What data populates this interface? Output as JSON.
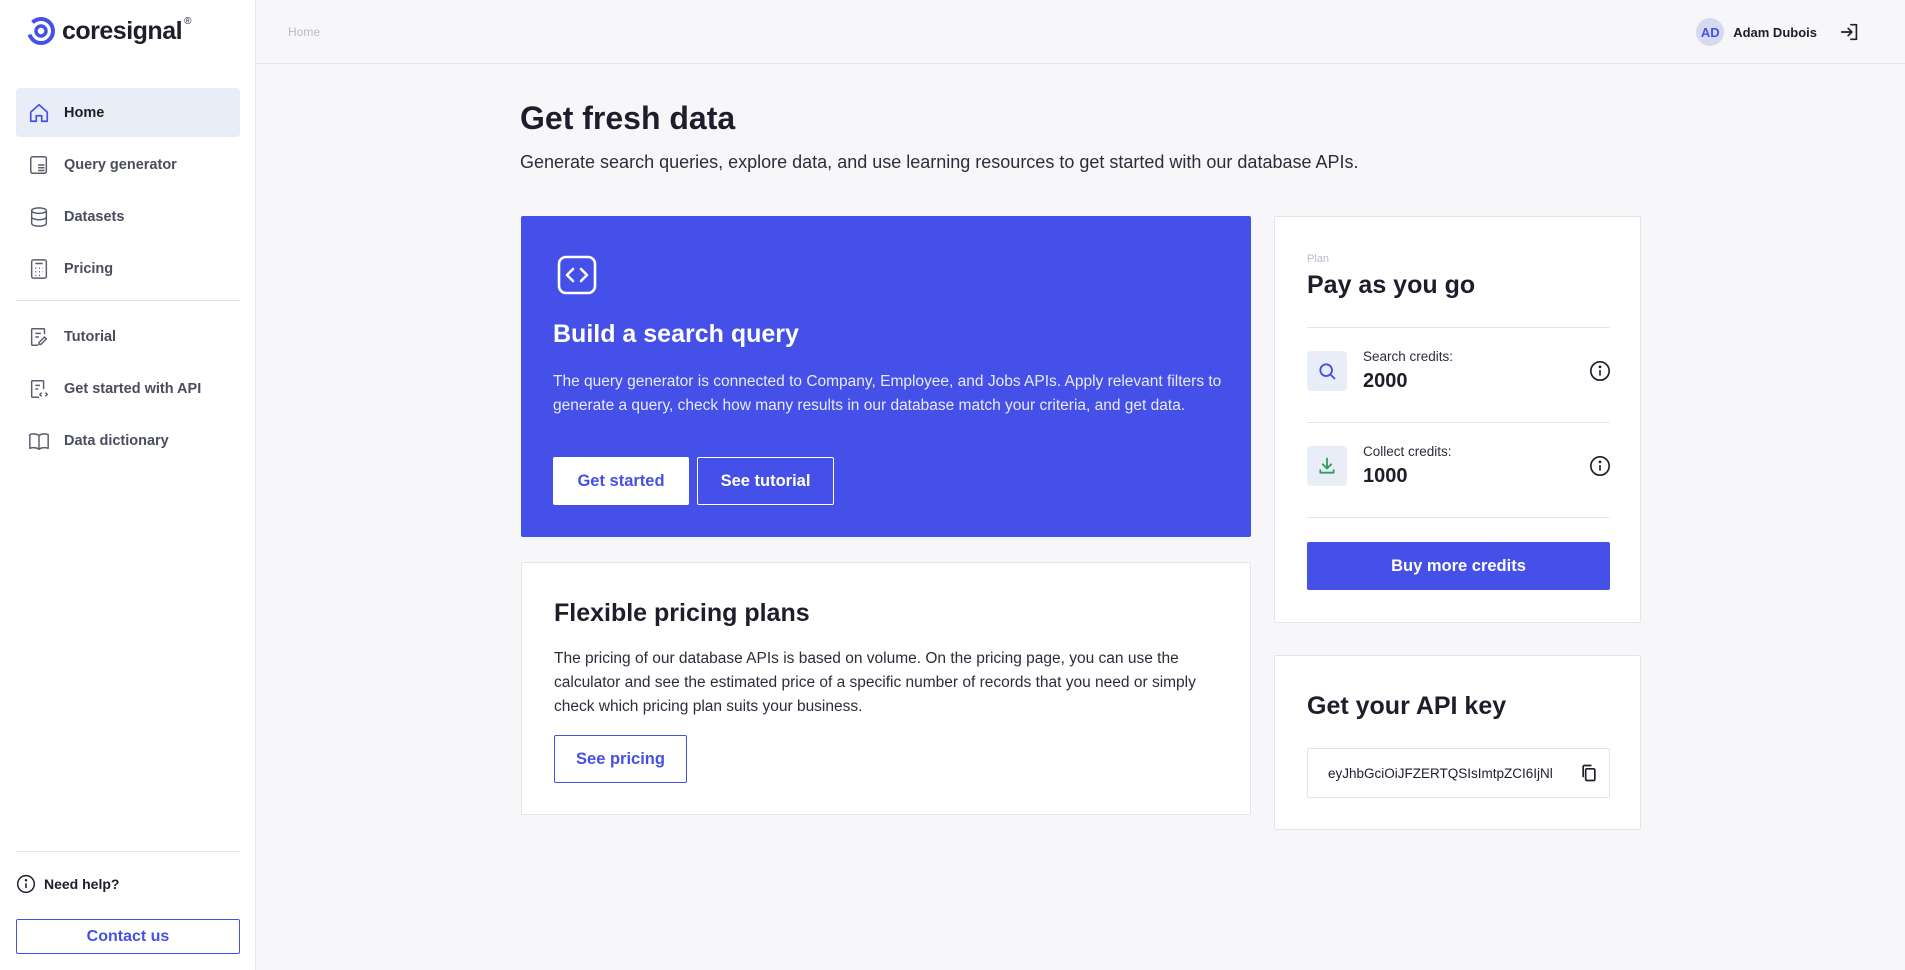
{
  "brand": {
    "name": "coresignal",
    "reg_mark": "®",
    "accent": "#4450e8"
  },
  "sidebar": {
    "items": [
      {
        "label": "Home",
        "icon": "home-icon",
        "active": true
      },
      {
        "label": "Query generator",
        "icon": "query-generator-icon"
      },
      {
        "label": "Datasets",
        "icon": "database-icon"
      },
      {
        "label": "Pricing",
        "icon": "calculator-icon"
      },
      {
        "label": "Tutorial",
        "icon": "tutorial-icon"
      },
      {
        "label": "Get started with API",
        "icon": "api-doc-icon"
      },
      {
        "label": "Data dictionary",
        "icon": "book-icon"
      }
    ],
    "help_label": "Need help?",
    "contact_label": "Contact us"
  },
  "header": {
    "breadcrumb": "Home",
    "user": {
      "initials": "AD",
      "name": "Adam Dubois"
    }
  },
  "main": {
    "title": "Get fresh data",
    "subtitle": "Generate search queries, explore data, and use learning resources to get started with our database APIs.",
    "query_card": {
      "title": "Build a search query",
      "text": "The query generator is connected to Company, Employee, and Jobs APIs. Apply relevant filters to generate a query, check how many results in our database match your criteria, and get data.",
      "primary_label": "Get started",
      "secondary_label": "See tutorial"
    },
    "pricing_card": {
      "title": "Flexible pricing plans",
      "text": "The pricing of our database APIs is based on volume. On the pricing page, you can use the calculator and see the estimated price of a specific number of records that you need or simply check which pricing plan suits your business.",
      "button_label": "See pricing"
    },
    "plan_card": {
      "label": "Plan",
      "name": "Pay as you go",
      "search_label": "Search credits:",
      "search_value": "2000",
      "collect_label": "Collect credits:",
      "collect_value": "1000",
      "buy_label": "Buy more credits"
    },
    "api_card": {
      "title": "Get your API key",
      "key": "eyJhbGciOiJFZERTQSIsImtpZCI6IjNl"
    }
  }
}
